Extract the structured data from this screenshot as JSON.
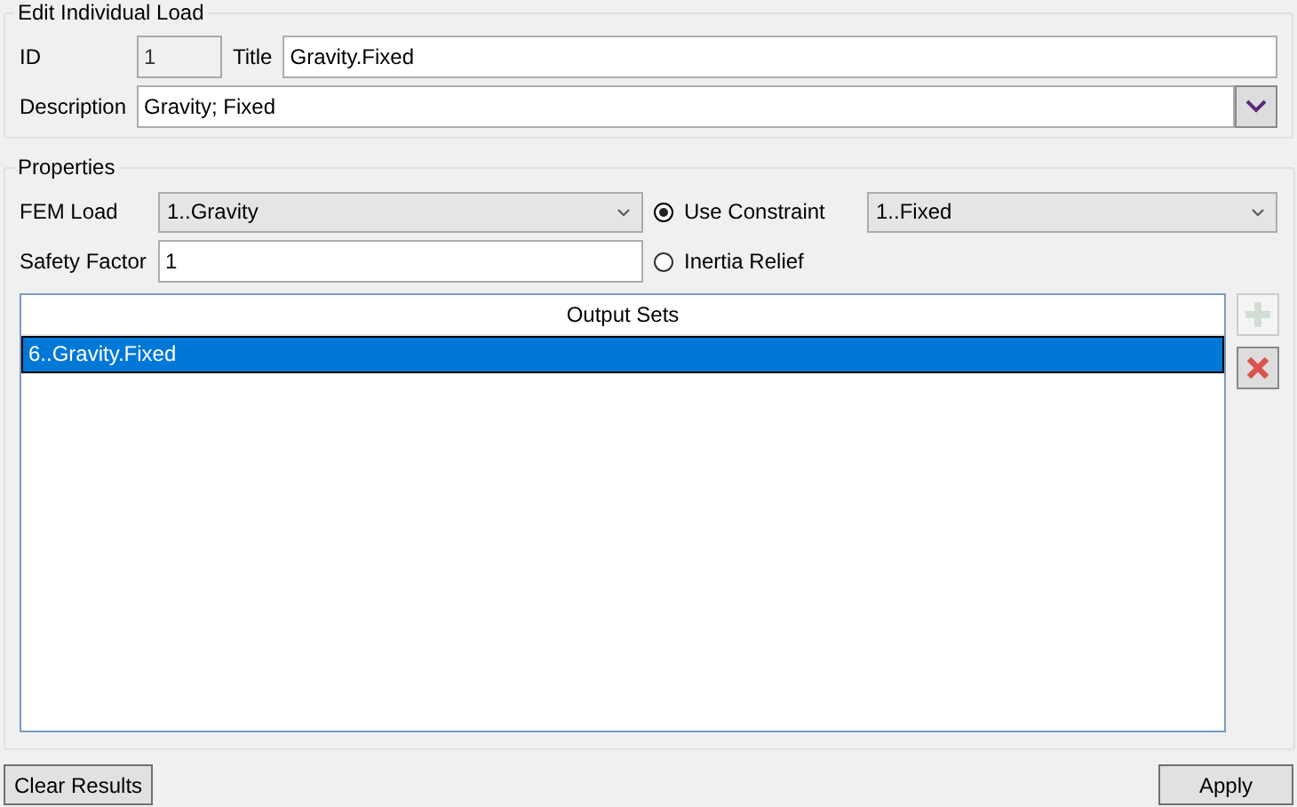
{
  "edit": {
    "title": "Edit Individual Load",
    "id_label": "ID",
    "id_field": {
      "value": "1",
      "disabled": true
    },
    "title_label": "Title",
    "title_value": "Gravity.Fixed",
    "description_label": "Description",
    "description_value": "Gravity; Fixed"
  },
  "properties": {
    "title": "Properties",
    "fem_load_label": "FEM Load",
    "fem_load_value": "1..Gravity",
    "safety_factor_label": "Safety Factor",
    "safety_factor_value": "1",
    "options": [
      {
        "label": "Use Constraint",
        "selected": true
      },
      {
        "label": "Inertia Relief",
        "selected": false
      }
    ],
    "constraint_value": "1..Fixed",
    "output_sets": {
      "header": "Output Sets",
      "rows": [
        {
          "label": "6..Gravity.Fixed",
          "selected": true
        }
      ]
    },
    "add_button": {
      "disabled": true
    },
    "delete_button": {
      "disabled": false
    }
  },
  "buttons": [
    {
      "label": "Clear Results"
    },
    {
      "label": "Apply"
    }
  ]
}
